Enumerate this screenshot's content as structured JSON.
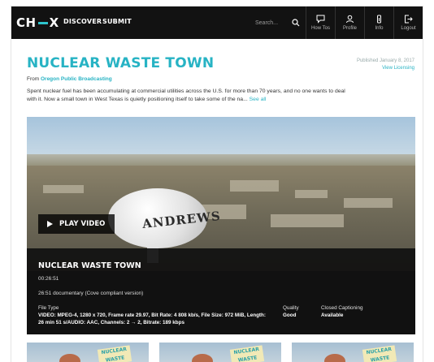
{
  "nav": {
    "logo_left": "CH",
    "logo_right": "X",
    "links": [
      "DISCOVER",
      "SUBMIT"
    ],
    "search_placeholder": "Search...",
    "icons": [
      {
        "name": "how-tos",
        "label": "How Tos",
        "icon": "comment-icon"
      },
      {
        "name": "profile",
        "label": "Profile",
        "icon": "user-icon"
      },
      {
        "name": "info",
        "label": "Info",
        "icon": "info-icon"
      },
      {
        "name": "logout",
        "label": "Logout",
        "icon": "logout-icon"
      }
    ]
  },
  "header": {
    "title": "NUCLEAR WASTE TOWN",
    "published": "Published January 8, 2017",
    "licensing": "View Licensing",
    "from_label": "From",
    "from_org": "Oregon Public Broadcasting",
    "description": "Spent nuclear fuel has been accumulating at commercial utilities across the U.S. for more than 70 years, and no one wants to deal with it. Now a small town in West Texas is quietly positioning itself to take some of the na...",
    "see_all": "See all"
  },
  "video": {
    "tank_text": "ANDREWS",
    "play_label": "PLAY VIDEO",
    "title": "NUCLEAR WASTE TOWN",
    "duration": "00:26:51",
    "documentary": "26:51 documentary (Cove compliant version)",
    "file_type_label": "File Type",
    "file_type_value": "VIDEO: MPEG-4, 1280 x 720, Frame rate 29.97, Bit Rate: 4 808 kb/s, File Size: 972 MiB, Length: 26 min 51 s/AUDIO: AAC, Channels: 2 → 2, Bitrate: 189 kbps",
    "quality_label": "Quality",
    "quality_value": "Good",
    "cc_label": "Closed Captioning",
    "cc_value": "Available"
  },
  "thumbnails": [
    {
      "logo_text": "NUCLEAR WASTE"
    },
    {
      "logo_text": "NUCLEAR WASTE"
    },
    {
      "logo_text": "NUCLEAR WASTE"
    }
  ],
  "colors": {
    "accent": "#27b3c4",
    "nav_bg": "#121212"
  }
}
